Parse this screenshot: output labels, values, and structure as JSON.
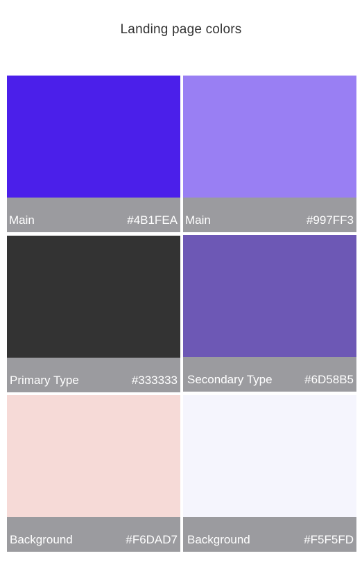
{
  "title": "Landing page colors",
  "swatches": [
    {
      "name": "Main",
      "hex": "#4B1FEA",
      "color": "#4B1FEA"
    },
    {
      "name": "Main",
      "hex": "#997FF3",
      "color": "#997FF3"
    },
    {
      "name": "Primary Type",
      "hex": "#333333",
      "color": "#333333"
    },
    {
      "name": "Secondary Type",
      "hex": "#6D58B5",
      "color": "#6D58B5"
    },
    {
      "name": "Background",
      "hex": "#F6DAD7",
      "color": "#F6DAD7"
    },
    {
      "name": "Background",
      "hex": "#F5F5FD",
      "color": "#F5F5FD"
    }
  ]
}
